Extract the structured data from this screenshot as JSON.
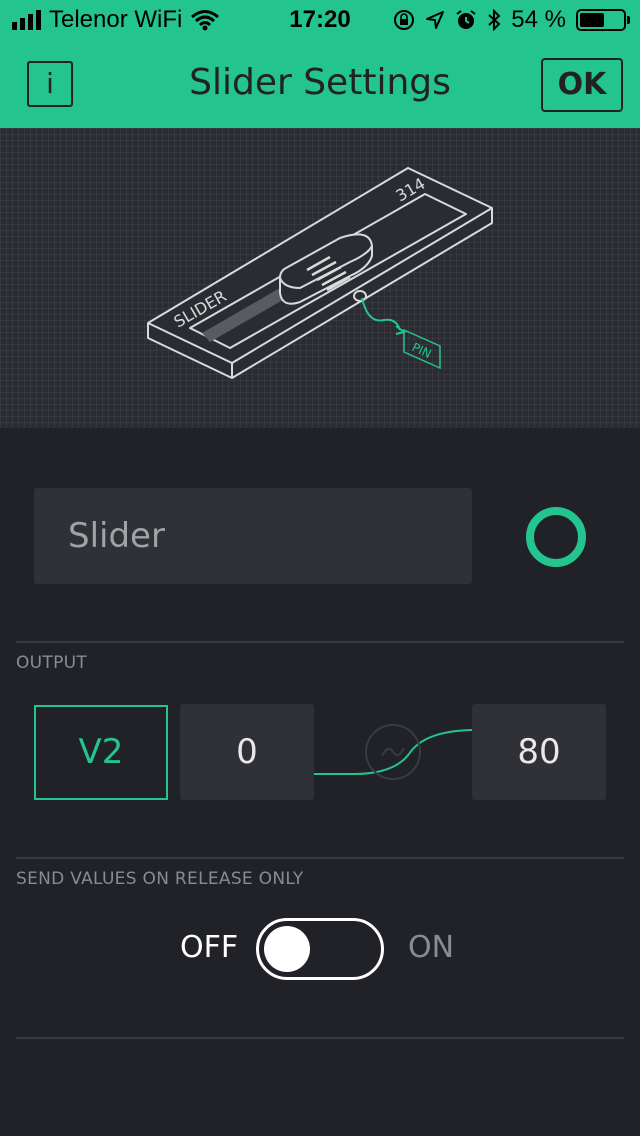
{
  "status_bar": {
    "carrier": "Telenor WiFi",
    "time": "17:20",
    "battery_percent": "54 %",
    "battery_level": 0.54
  },
  "header": {
    "info_label": "i",
    "title": "Slider Settings",
    "ok_label": "OK"
  },
  "illustration": {
    "widget_label": "SLIDER",
    "value_label": "314",
    "pin_label": "PIN"
  },
  "name_field": {
    "value": "Slider"
  },
  "colors": {
    "accent": "#23c48e",
    "background": "#212227",
    "field": "#303136"
  },
  "output": {
    "label": "OUTPUT",
    "pin": "V2",
    "min": "0",
    "max": "80"
  },
  "release": {
    "label": "SEND VALUES ON RELEASE ONLY",
    "off_label": "OFF",
    "on_label": "ON",
    "state": "off"
  }
}
